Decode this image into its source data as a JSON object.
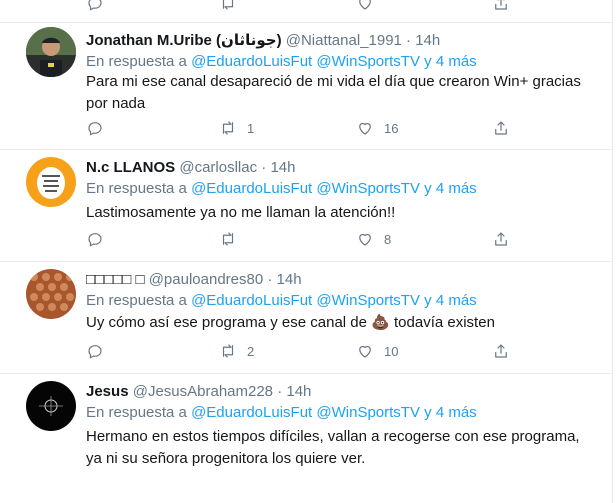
{
  "reply_prefix": "En respuesta a",
  "tweets": [
    {
      "name": "Jonathan M.Uribe (جوناثان)",
      "handle": "@Niattanal_1991",
      "time": "14h",
      "reply_to": [
        "@EduardoLuisFut",
        "@WinSportsTV"
      ],
      "more": "y 4 más",
      "text": "Para mi ese canal desapareció de mi vida el día que crearon Win+ gracias por nada",
      "retweets": "1",
      "likes": "16"
    },
    {
      "name": "N.c LLANOS",
      "handle": "@carlosllac",
      "time": "14h",
      "reply_to": [
        "@EduardoLuisFut",
        "@WinSportsTV"
      ],
      "more": "y 4 más",
      "text": "Lastimosamente ya no me llaman la atención!!",
      "retweets": "",
      "likes": "8"
    },
    {
      "name": "□□□□□ □",
      "handle": "@pauloandres80",
      "time": "14h",
      "reply_to": [
        "@EduardoLuisFut",
        "@WinSportsTV"
      ],
      "more": "y 4 más",
      "text_before": "Uy cómo así ese programa y ese canal de",
      "emoji": "💩",
      "text_after": "todavía existen",
      "retweets": "2",
      "likes": "10"
    },
    {
      "name": "Jesus",
      "handle": "@JesusAbraham228",
      "time": "14h",
      "reply_to": [
        "@EduardoLuisFut",
        "@WinSportsTV"
      ],
      "more": "y 4 más",
      "text": "Hermano en estos tiempos difíciles, vallan a recogerse con ese programa, ya ni su señora progenitora los quiere ver."
    }
  ],
  "colors": {
    "link": "#1da1f2",
    "muted": "#657786",
    "text": "#14171a",
    "border": "#e6ecf0",
    "avatar2": "#f7a11a"
  }
}
